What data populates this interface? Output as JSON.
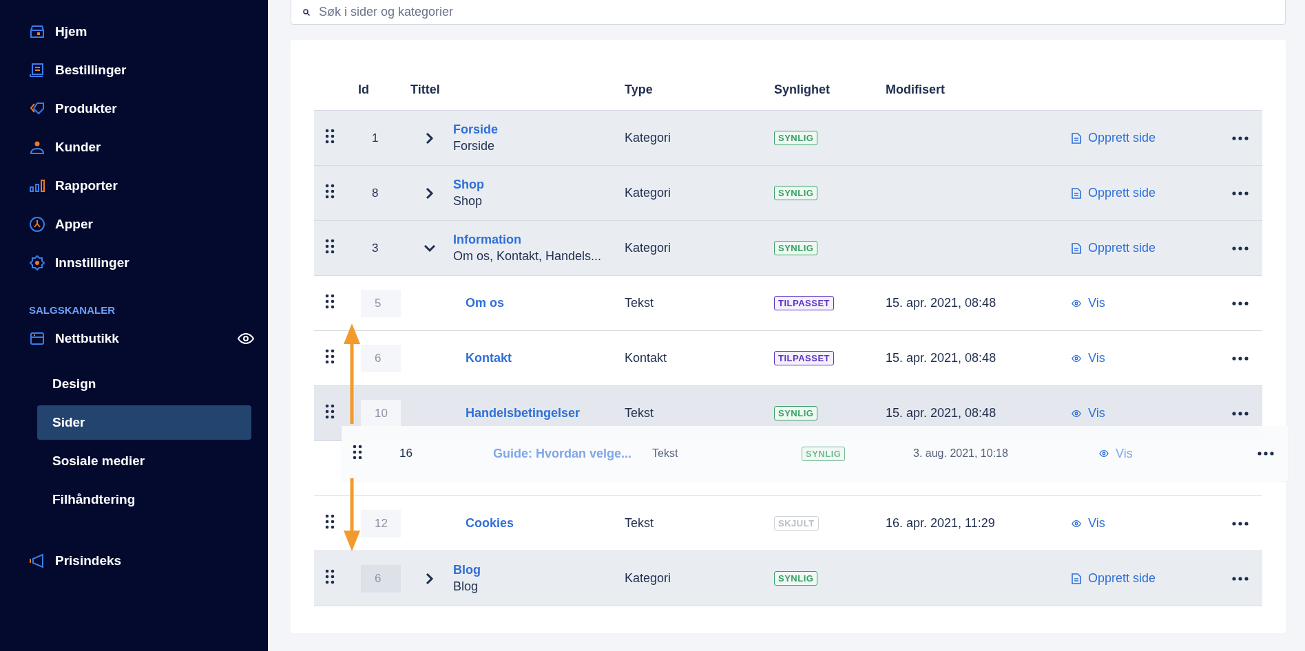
{
  "sidebar": {
    "nav": [
      {
        "label": "Hjem"
      },
      {
        "label": "Bestillinger"
      },
      {
        "label": "Produkter"
      },
      {
        "label": "Kunder"
      },
      {
        "label": "Rapporter"
      },
      {
        "label": "Apper"
      },
      {
        "label": "Innstillinger"
      }
    ],
    "section_title": "SALGSKANALER",
    "channel": {
      "label": "Nettbutikk"
    },
    "subitems": [
      {
        "label": "Design",
        "selected": false
      },
      {
        "label": "Sider",
        "selected": true
      },
      {
        "label": "Sosiale medier",
        "selected": false
      },
      {
        "label": "Filhåndtering",
        "selected": false
      }
    ],
    "footer_items": [
      {
        "label": "Prisindeks"
      }
    ]
  },
  "search": {
    "placeholder": "Søk i sider og kategorier"
  },
  "table": {
    "columns": [
      "Id",
      "Tittel",
      "Type",
      "Synlighet",
      "Modifisert"
    ],
    "rows": [
      {
        "kind": "category",
        "id": "1",
        "title": "Forside",
        "subtitle": "Forside",
        "expanded": false,
        "dimmed": false,
        "hovered": false,
        "dragging": false,
        "type": "Kategori",
        "visibility": {
          "label": "SYNLIG",
          "kind": "visible"
        },
        "action": {
          "label": "Opprett side",
          "kind": "create"
        }
      },
      {
        "kind": "category",
        "id": "8",
        "title": "Shop",
        "subtitle": "Shop",
        "expanded": false,
        "dimmed": false,
        "hovered": false,
        "dragging": false,
        "type": "Kategori",
        "visibility": {
          "label": "SYNLIG",
          "kind": "visible"
        },
        "action": {
          "label": "Opprett side",
          "kind": "create"
        }
      },
      {
        "kind": "category",
        "id": "3",
        "title": "Information",
        "subtitle": "Om os, Kontakt, Handels...",
        "expanded": true,
        "dimmed": false,
        "hovered": false,
        "dragging": false,
        "type": "Kategori",
        "visibility": {
          "label": "SYNLIG",
          "kind": "visible"
        },
        "action": {
          "label": "Opprett side",
          "kind": "create"
        }
      },
      {
        "kind": "page",
        "id": "5",
        "title": "Om os",
        "dimmed": true,
        "hovered": false,
        "dragging": false,
        "type": "Tekst",
        "visibility": {
          "label": "TILPASSET",
          "kind": "custom"
        },
        "modified": "15. apr. 2021, 08:48",
        "action": {
          "label": "Vis",
          "kind": "view"
        }
      },
      {
        "kind": "page",
        "id": "6",
        "title": "Kontakt",
        "dimmed": true,
        "hovered": false,
        "dragging": false,
        "type": "Kontakt",
        "visibility": {
          "label": "TILPASSET",
          "kind": "custom"
        },
        "modified": "15. apr. 2021, 08:48",
        "action": {
          "label": "Vis",
          "kind": "view"
        }
      },
      {
        "kind": "page",
        "id": "10",
        "title": "Handelsbetingelser",
        "dimmed": true,
        "hovered": true,
        "dragging": false,
        "type": "Tekst",
        "visibility": {
          "label": "SYNLIG",
          "kind": "visible"
        },
        "modified": "15. apr. 2021, 08:48",
        "action": {
          "label": "Vis",
          "kind": "view"
        }
      },
      {
        "kind": "page",
        "id": "16",
        "title": "Guide: Hvordan velge...",
        "dimmed": false,
        "hovered": false,
        "dragging": true,
        "type": "Tekst",
        "visibility": {
          "label": "SYNLIG",
          "kind": "visible"
        },
        "modified": "3. aug. 2021, 10:18",
        "action": {
          "label": "Vis",
          "kind": "view"
        }
      },
      {
        "kind": "page",
        "id": "12",
        "title": "Cookies",
        "dimmed": true,
        "hovered": false,
        "dragging": false,
        "type": "Tekst",
        "visibility": {
          "label": "SKJULT",
          "kind": "hidden"
        },
        "modified": "16. apr. 2021, 11:29",
        "action": {
          "label": "Vis",
          "kind": "view"
        }
      },
      {
        "kind": "category",
        "id": "6",
        "title": "Blog",
        "subtitle": "Blog",
        "expanded": false,
        "dimmed": true,
        "hovered": false,
        "dragging": false,
        "type": "Kategori",
        "visibility": {
          "label": "SYNLIG",
          "kind": "visible"
        },
        "action": {
          "label": "Opprett side",
          "kind": "create"
        }
      }
    ]
  }
}
